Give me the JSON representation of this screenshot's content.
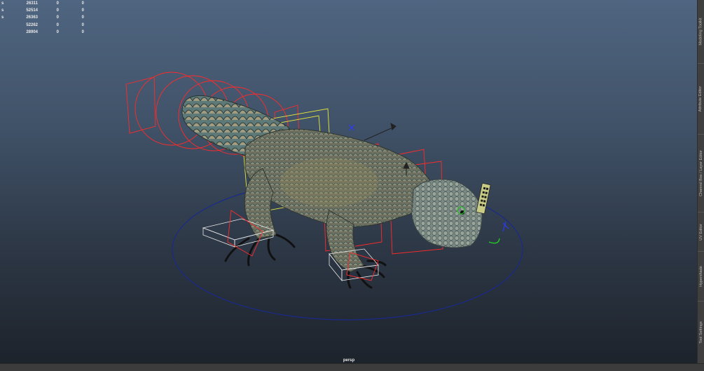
{
  "hud": {
    "rows": [
      {
        "label": "s",
        "v1": "26311",
        "v2": "0",
        "v3": "0"
      },
      {
        "label": "s",
        "v1": "52514",
        "v2": "0",
        "v3": "0"
      },
      {
        "label": "s",
        "v1": "26363",
        "v2": "0",
        "v3": "0"
      },
      {
        "label": "",
        "v1": "52262",
        "v2": "0",
        "v3": "0"
      },
      {
        "label": "",
        "v1": "28904",
        "v2": "0",
        "v3": "0"
      }
    ]
  },
  "viewport": {
    "camera_label": "persp",
    "background_top": "#4f6580",
    "background_bottom": "#1d232b"
  },
  "rig_colors": {
    "control_red": "#ff2a2a",
    "control_yellow": "#e8e83a",
    "ground_circle": "#1a2a8a",
    "selection_white": "#e8e8e8",
    "gizmo_green": "#22cc22"
  },
  "side_tabs": [
    {
      "label": "Modeling Toolkit"
    },
    {
      "label": "Attribute Editor"
    },
    {
      "label": "Channel Box / Layer Editor"
    },
    {
      "label": "UV Editor"
    },
    {
      "label": "Hypershade"
    },
    {
      "label": "Tool Settings"
    }
  ]
}
